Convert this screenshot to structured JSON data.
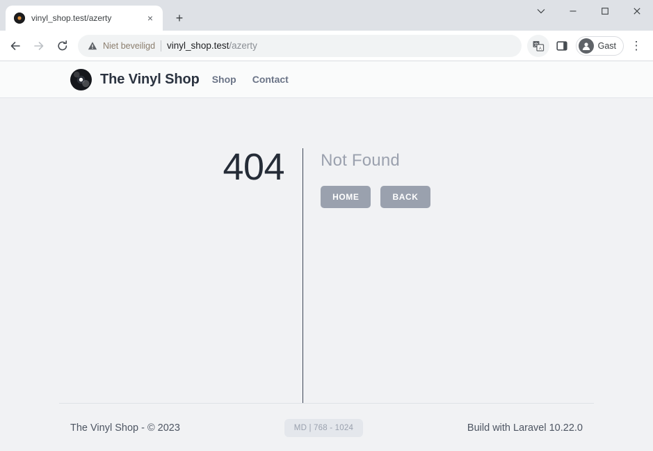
{
  "browser": {
    "tab": {
      "title": "vinyl_shop.test/azerty",
      "favicon_name": "vinyl-record-favicon",
      "close_label": "×"
    },
    "new_tab_label": "+",
    "window_controls": {
      "tab_search": "⌄",
      "minimize": "–",
      "maximize": "□",
      "close": "✕"
    },
    "toolbar": {
      "back": "←",
      "forward": "→",
      "reload": "⟳",
      "security_label": "Niet beveiligd",
      "url_host": "vinyl_shop.test",
      "url_path": "/azerty",
      "translate_icon": "translate-icon",
      "side_panel_icon": "side-panel-icon",
      "profile_name": "Gast",
      "menu": "⋮"
    }
  },
  "page": {
    "header": {
      "logo_name": "vinyl-record-logo",
      "brand": "The Vinyl Shop",
      "nav": [
        {
          "label": "Shop"
        },
        {
          "label": "Contact"
        }
      ]
    },
    "error": {
      "code": "404",
      "message": "Not Found",
      "buttons": [
        {
          "label": "HOME"
        },
        {
          "label": "BACK"
        }
      ]
    },
    "footer": {
      "copyright": "The Vinyl Shop - © 2023",
      "breakpoint_badge": "MD | 768 - 1024",
      "credit": "Build with Laravel 10.22.0"
    }
  },
  "colors": {
    "tabstrip": "#dee1e6",
    "page_bg": "#f1f2f4",
    "header_bg": "#fafbfb",
    "error_code": "#252c37",
    "error_message": "#9ba1ae",
    "button_bg": "#9aa1ae",
    "badge_bg": "#e4e7ec"
  }
}
